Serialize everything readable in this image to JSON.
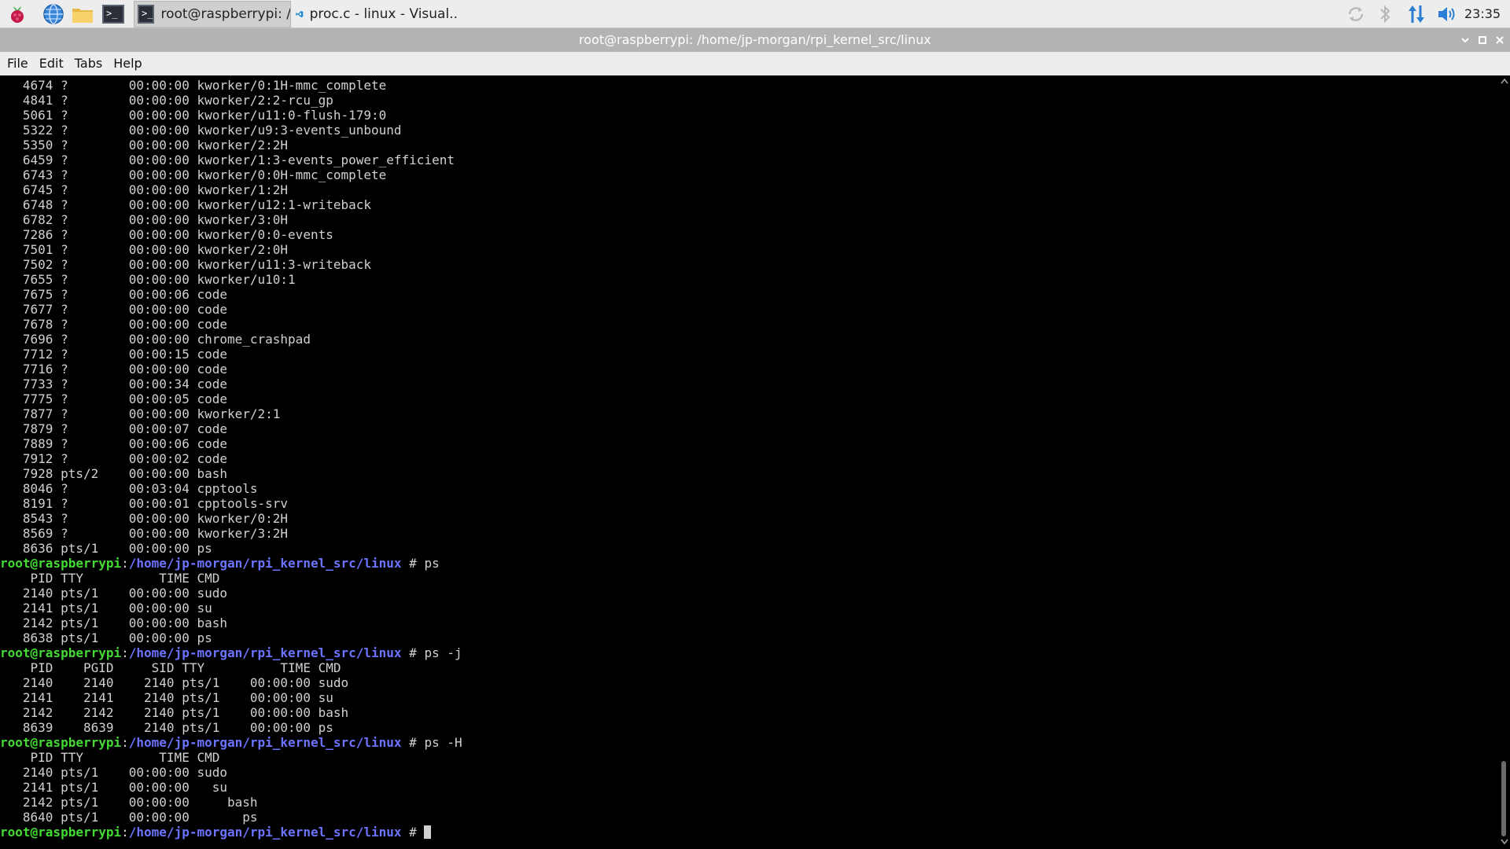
{
  "taskbar": {
    "tasks": [
      {
        "label": "root@raspberrypi: /h..",
        "active": true
      },
      {
        "label": "proc.c - linux - Visual..",
        "active": false
      }
    ],
    "launchers": [
      "raspberry-menu-icon",
      "browser-globe-icon",
      "file-manager-folder-icon",
      "terminal-icon"
    ],
    "terminal_glyph": ">_",
    "clock": "23:35"
  },
  "window": {
    "title": "root@raspberrypi: /home/jp-morgan/rpi_kernel_src/linux"
  },
  "menu": [
    "File",
    "Edit",
    "Tabs",
    "Help"
  ],
  "prompt": {
    "user": "root@raspberrypi",
    "colon": ":",
    "path": "/home/jp-morgan/rpi_kernel_src/linux",
    "symbol": " # "
  },
  "terminal": {
    "lines": [
      {
        "text": "   4674 ?        00:00:00 kworker/0:1H-mmc_complete"
      },
      {
        "text": "   4841 ?        00:00:00 kworker/2:2-rcu_gp"
      },
      {
        "text": "   5061 ?        00:00:00 kworker/u11:0-flush-179:0"
      },
      {
        "text": "   5322 ?        00:00:00 kworker/u9:3-events_unbound"
      },
      {
        "text": "   5350 ?        00:00:00 kworker/2:2H"
      },
      {
        "text": "   6459 ?        00:00:00 kworker/1:3-events_power_efficient"
      },
      {
        "text": "   6743 ?        00:00:00 kworker/0:0H-mmc_complete"
      },
      {
        "text": "   6745 ?        00:00:00 kworker/1:2H"
      },
      {
        "text": "   6748 ?        00:00:00 kworker/u12:1-writeback"
      },
      {
        "text": "   6782 ?        00:00:00 kworker/3:0H"
      },
      {
        "text": "   7286 ?        00:00:00 kworker/0:0-events"
      },
      {
        "text": "   7501 ?        00:00:00 kworker/2:0H"
      },
      {
        "text": "   7502 ?        00:00:00 kworker/u11:3-writeback"
      },
      {
        "text": "   7655 ?        00:00:00 kworker/u10:1"
      },
      {
        "text": "   7675 ?        00:00:06 code"
      },
      {
        "text": "   7677 ?        00:00:00 code"
      },
      {
        "text": "   7678 ?        00:00:00 code"
      },
      {
        "text": "   7696 ?        00:00:00 chrome_crashpad"
      },
      {
        "text": "   7712 ?        00:00:15 code"
      },
      {
        "text": "   7716 ?        00:00:00 code"
      },
      {
        "text": "   7733 ?        00:00:34 code"
      },
      {
        "text": "   7775 ?        00:00:05 code"
      },
      {
        "text": "   7877 ?        00:00:00 kworker/2:1"
      },
      {
        "text": "   7879 ?        00:00:07 code"
      },
      {
        "text": "   7889 ?        00:00:06 code"
      },
      {
        "text": "   7912 ?        00:00:02 code"
      },
      {
        "text": "   7928 pts/2    00:00:00 bash"
      },
      {
        "text": "   8046 ?        00:03:04 cpptools"
      },
      {
        "text": "   8191 ?        00:00:01 cpptools-srv"
      },
      {
        "text": "   8543 ?        00:00:00 kworker/0:2H"
      },
      {
        "text": "   8569 ?        00:00:00 kworker/3:2H"
      },
      {
        "text": "   8636 pts/1    00:00:00 ps"
      },
      {
        "prompt": true,
        "cmd": "ps"
      },
      {
        "text": "    PID TTY          TIME CMD"
      },
      {
        "text": "   2140 pts/1    00:00:00 sudo"
      },
      {
        "text": "   2141 pts/1    00:00:00 su"
      },
      {
        "text": "   2142 pts/1    00:00:00 bash"
      },
      {
        "text": "   8638 pts/1    00:00:00 ps"
      },
      {
        "prompt": true,
        "cmd": "ps -j"
      },
      {
        "text": "    PID    PGID     SID TTY          TIME CMD"
      },
      {
        "text": "   2140    2140    2140 pts/1    00:00:00 sudo"
      },
      {
        "text": "   2141    2141    2140 pts/1    00:00:00 su"
      },
      {
        "text": "   2142    2142    2140 pts/1    00:00:00 bash"
      },
      {
        "text": "   8639    8639    2140 pts/1    00:00:00 ps"
      },
      {
        "prompt": true,
        "cmd": "ps -H"
      },
      {
        "text": "    PID TTY          TIME CMD"
      },
      {
        "text": "   2140 pts/1    00:00:00 sudo"
      },
      {
        "text": "   2141 pts/1    00:00:00   su"
      },
      {
        "text": "   2142 pts/1    00:00:00     bash"
      },
      {
        "text": "   8640 pts/1    00:00:00       ps"
      },
      {
        "prompt": true,
        "cmd": "",
        "cursor": true
      }
    ]
  },
  "colors": {
    "prompt_user": "#44d934",
    "prompt_path": "#6c73ff",
    "terminal_text": "#d0d0d0",
    "terminal_bg": "#000000",
    "vscode_blue": "#1f8ad2",
    "tray_blue": "#2a7fd4"
  }
}
